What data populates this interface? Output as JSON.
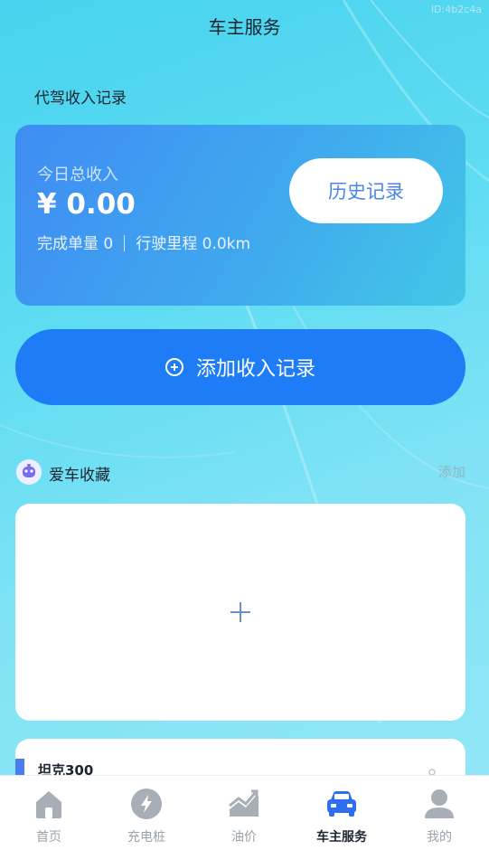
{
  "watermark": "ID:4b2c4a",
  "page_title": "车主服务",
  "section_title": "代驾收入记录",
  "income": {
    "label": "今日总收入",
    "amount": "¥ 0.00",
    "orders": "完成单量 0",
    "mileage": "行驶里程 0.0km",
    "history_label": "历史记录"
  },
  "add_income_label": "添加收入记录",
  "favorites": {
    "title": "爱车收藏",
    "add_label": "添加",
    "car_name": "坦克300"
  },
  "tabs": [
    {
      "label": "首页",
      "icon": "home-icon"
    },
    {
      "label": "充电桩",
      "icon": "charging-icon"
    },
    {
      "label": "油价",
      "icon": "trend-icon"
    },
    {
      "label": "车主服务",
      "icon": "car-icon",
      "active": true
    },
    {
      "label": "我的",
      "icon": "user-icon"
    }
  ],
  "colors": {
    "primary": "#1e7cf6",
    "tab_active": "#2f6df2",
    "tab_inactive": "#a7aeb5"
  }
}
